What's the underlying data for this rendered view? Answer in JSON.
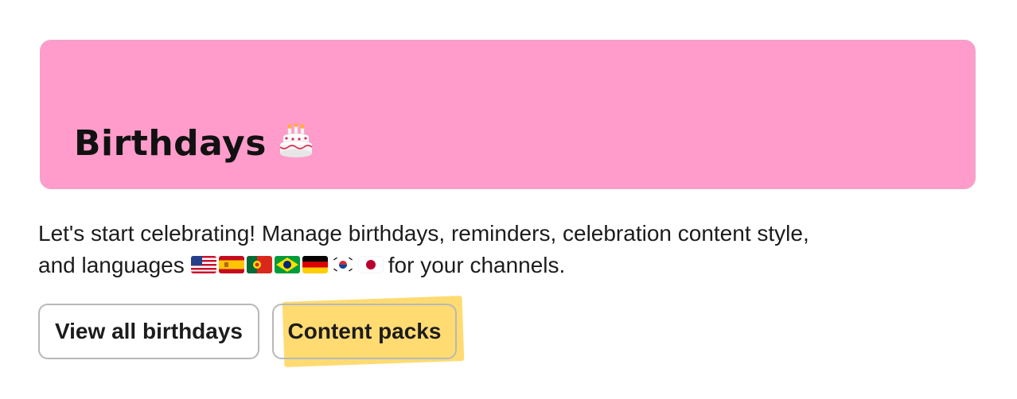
{
  "banner": {
    "title": "Birthdays",
    "icon": "birthday-cake-icon",
    "background_color": "#ff9ccb"
  },
  "description": {
    "line1": "Let's start celebrating! Manage birthdays, reminders, celebration content style,",
    "line2_prefix": "and languages",
    "line2_suffix": "for your channels.",
    "flags": [
      "us-flag-icon",
      "spain-flag-icon",
      "portugal-flag-icon",
      "brazil-flag-icon",
      "germany-flag-icon",
      "south-korea-flag-icon",
      "japan-flag-icon"
    ]
  },
  "buttons": {
    "view_all": "View all birthdays",
    "content_packs": "Content packs"
  },
  "highlight_color": "#ffd96a"
}
